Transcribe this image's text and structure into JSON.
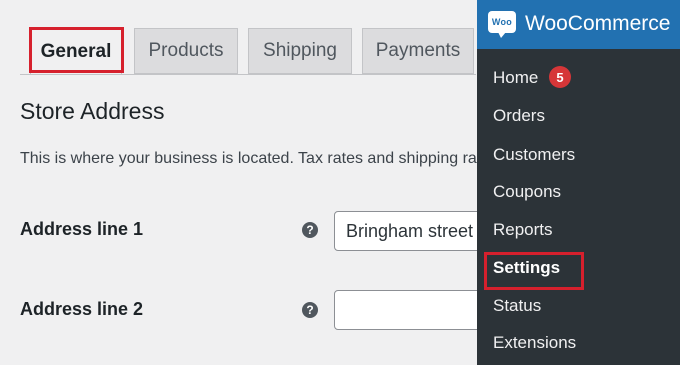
{
  "tabs": [
    {
      "label": "General",
      "active": true
    },
    {
      "label": "Products"
    },
    {
      "label": "Shipping"
    },
    {
      "label": "Payments"
    }
  ],
  "section": {
    "title": "Store Address",
    "description": "This is where your business is located. Tax rates and shipping rates will use this address."
  },
  "fields": [
    {
      "label": "Address line 1",
      "value": "Bringham street",
      "help_icon": "question-circle-icon"
    },
    {
      "label": "Address line 2",
      "value": "",
      "help_icon": "question-circle-icon"
    }
  ],
  "menu": {
    "logo_text": "Woo",
    "title": "WooCommerce",
    "home_badge": "5",
    "items": [
      "Home",
      "Orders",
      "Customers",
      "Coupons",
      "Reports",
      "Settings",
      "Status",
      "Extensions"
    ],
    "current": "Settings"
  },
  "colors": {
    "highlight": "#d6202d",
    "menu_header": "#2271b1",
    "menu_bg": "#2c3338",
    "badge": "#d63638"
  }
}
